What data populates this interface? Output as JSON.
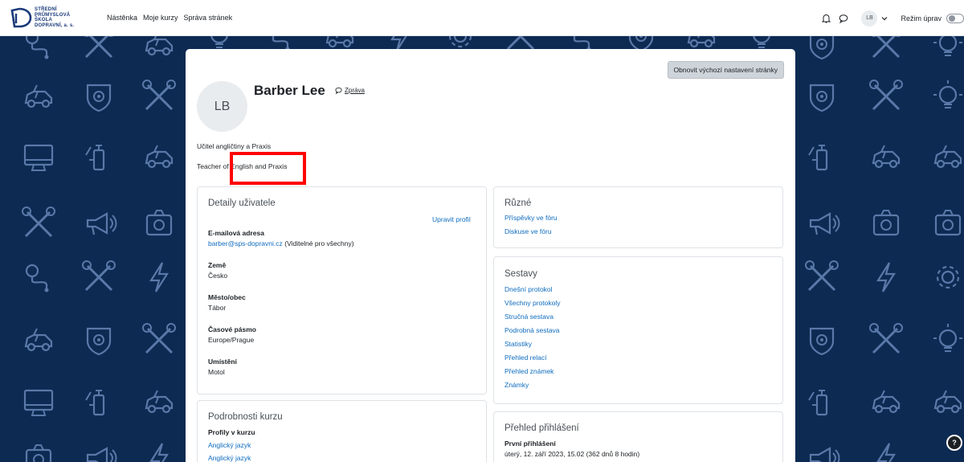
{
  "logo": {
    "lines": [
      "STŘEDNÍ",
      "PRŮMYSLOVÁ",
      "ŠKOLA",
      "DOPRAVNÍ, a. s."
    ]
  },
  "nav": {
    "links": [
      "Nástěnka",
      "Moje kurzy",
      "Správa stránek"
    ],
    "user_initials": "LB",
    "edit_mode_label": "Režim úprav"
  },
  "page": {
    "reset_button": "Obnovit výchozí nastavení stránky",
    "avatar_initials": "LB",
    "name": "Barber Lee",
    "message_link": "Zpráva",
    "description_cs": "Učitel angličtiny a Praxis",
    "description_en": "Teacher of English and Praxis"
  },
  "user_details": {
    "title": "Detaily uživatele",
    "edit_profile": "Upravit profil",
    "email_label": "E-mailová adresa",
    "email_value": "barber@sps-dopravni.cz",
    "email_note": "(Viditelné pro všechny)",
    "country_label": "Země",
    "country_value": "Česko",
    "city_label": "Město/obec",
    "city_value": "Tábor",
    "timezone_label": "Časové pásmo",
    "timezone_value": "Europe/Prague",
    "location_label": "Umístění",
    "location_value": "Motol"
  },
  "misc": {
    "title": "Různé",
    "links": [
      "Příspěvky ve fóru",
      "Diskuse ve fóru"
    ]
  },
  "reports": {
    "title": "Sestavy",
    "links": [
      "Dnešní protokol",
      "Všechny protokoly",
      "Stručná sestava",
      "Podrobná sestava",
      "Statistiky",
      "Přehled relací",
      "Přehled známek",
      "Známky"
    ]
  },
  "course_details": {
    "title": "Podrobnosti kurzu",
    "profiles_label": "Profily v kurzu",
    "courses": [
      "Anglický jazyk",
      "Anglický jazyk"
    ]
  },
  "login": {
    "title": "Přehled přihlášení",
    "first_label": "První přihlášení",
    "first_value": "úterý, 12. září 2023, 15.02  (362 dnů 8 hodin)"
  },
  "help_label": "?",
  "colors": {
    "background": "#0d2a52",
    "link": "#0f6cbf",
    "highlight": "#ff0000"
  }
}
